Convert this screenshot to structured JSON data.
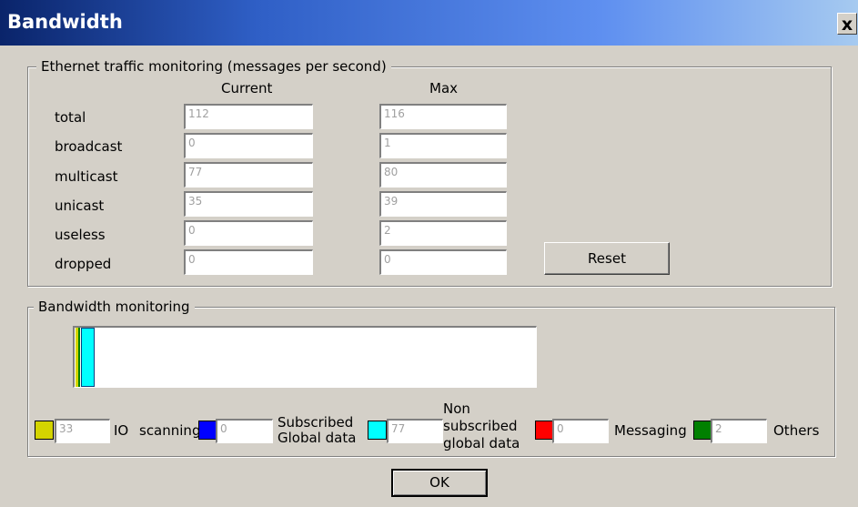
{
  "window": {
    "title": "Bandwidth",
    "close_symbol": "x"
  },
  "traffic": {
    "legend": "Ethernet traffic monitoring (messages per second)",
    "col_current": "Current",
    "col_max": "Max",
    "rows": [
      {
        "label": "total",
        "current": "112",
        "max": "116"
      },
      {
        "label": "broadcast",
        "current": "0",
        "max": "1"
      },
      {
        "label": "multicast",
        "current": "77",
        "max": "80"
      },
      {
        "label": "unicast",
        "current": "35",
        "max": "39"
      },
      {
        "label": "useless",
        "current": "0",
        "max": "2"
      },
      {
        "label": "dropped",
        "current": "0",
        "max": "0"
      }
    ],
    "reset_label": "Reset"
  },
  "bandwidth": {
    "legend": "Bandwidth monitoring",
    "bar_fraction": 0.032,
    "legend_items": [
      {
        "color": "#d4d400",
        "value": "33",
        "label": [
          "IO",
          "scanning"
        ]
      },
      {
        "color": "#0000ff",
        "value": "0",
        "label": [
          "Subscribed",
          "Global data"
        ]
      },
      {
        "color": "#00ffff",
        "value": "77",
        "label": [
          "Non",
          "subscribed",
          "global data"
        ]
      },
      {
        "color": "#ff0000",
        "value": "0",
        "label": [
          "Messaging"
        ]
      },
      {
        "color": "#008000",
        "value": "2",
        "label": [
          "Others"
        ]
      }
    ]
  },
  "ok_label": "OK"
}
